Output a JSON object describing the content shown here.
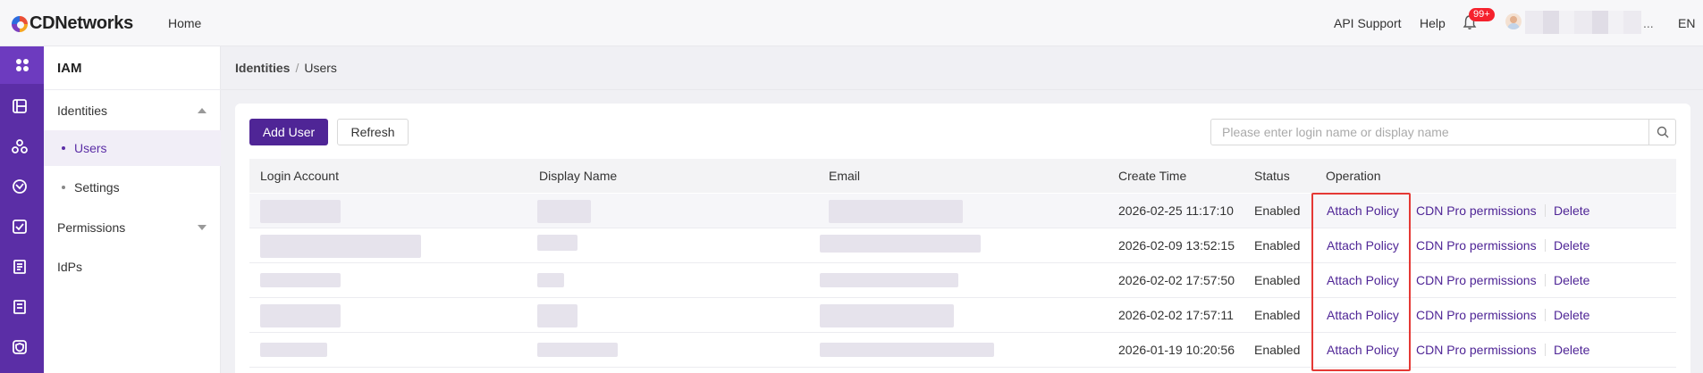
{
  "header": {
    "logo": "CDNetworks",
    "home": "Home",
    "api_support": "API Support",
    "help": "Help",
    "notification_count": "99+",
    "username_ellipsis": "...",
    "language": "EN"
  },
  "iconbar": {
    "icons": [
      "apps-icon",
      "storage-icon",
      "network-icon",
      "security-icon",
      "task-icon",
      "report-icon",
      "document-icon",
      "shield-icon"
    ]
  },
  "sidebar": {
    "title": "IAM",
    "items": [
      {
        "label": "Identities"
      },
      {
        "label": "Users"
      },
      {
        "label": "Settings"
      },
      {
        "label": "Permissions"
      },
      {
        "label": "IdPs"
      }
    ]
  },
  "breadcrumb": {
    "parent": "Identities",
    "separator": "/",
    "current": "Users"
  },
  "toolbar": {
    "add_user": "Add User",
    "refresh": "Refresh",
    "search_placeholder": "Please enter login name or display name"
  },
  "table": {
    "columns": [
      "Login Account",
      "Display Name",
      "Email",
      "Create Time",
      "Status",
      "Operation"
    ],
    "operations": [
      "Attach Policy",
      "CDN Pro permissions",
      "Delete"
    ],
    "rows": [
      {
        "create_time": "2026-02-25 11:17:10",
        "status": "Enabled"
      },
      {
        "create_time": "2026-02-09 13:52:15",
        "status": "Enabled"
      },
      {
        "create_time": "2026-02-02 17:57:50",
        "status": "Enabled"
      },
      {
        "create_time": "2026-02-02 17:57:11",
        "status": "Enabled"
      },
      {
        "create_time": "2026-01-19 10:20:56",
        "status": "Enabled"
      }
    ]
  },
  "colors": {
    "brand": "#5b2ea6",
    "primary_button": "#4f2596",
    "highlight": "#e53935"
  }
}
